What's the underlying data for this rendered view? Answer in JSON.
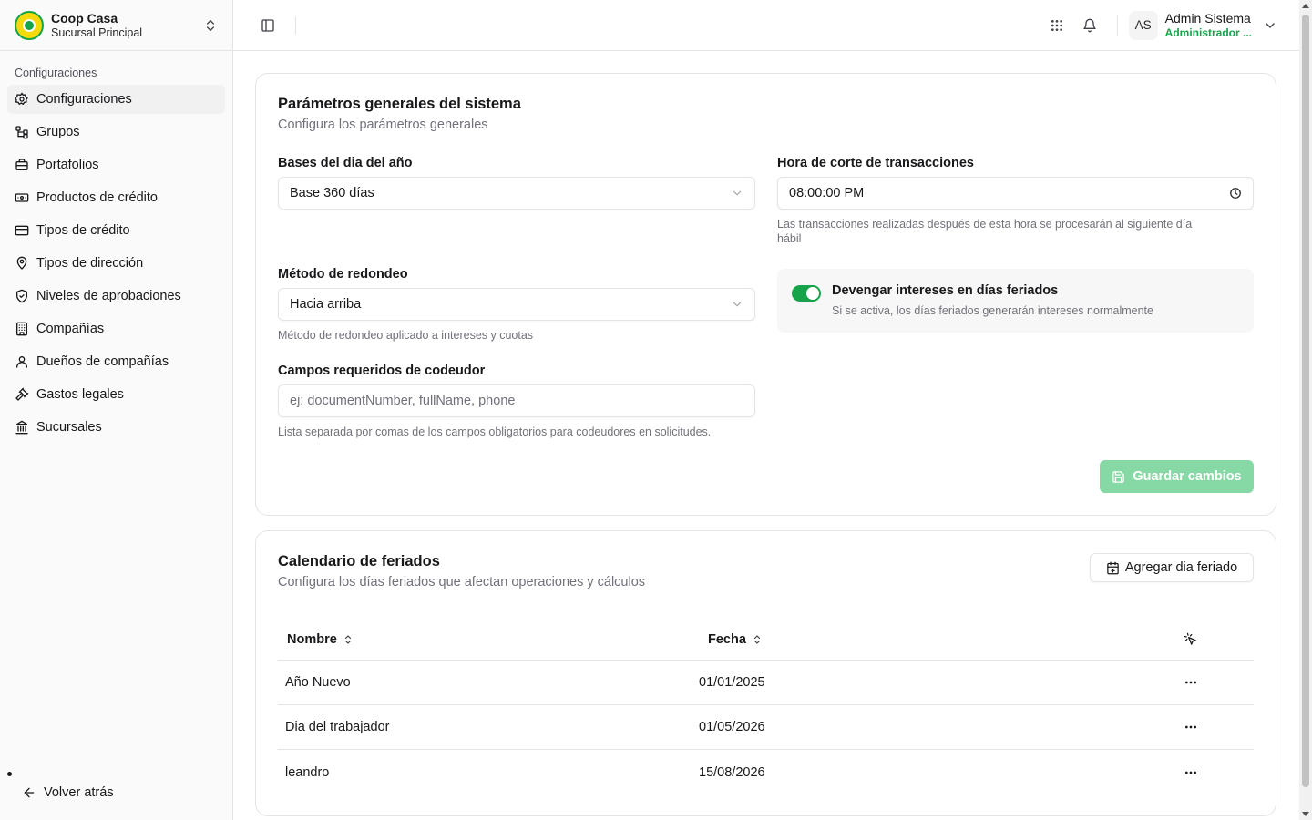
{
  "brand": {
    "name": "Coop Casa",
    "branch": "Sucursal Principal"
  },
  "sidebar": {
    "group_label": "Configuraciones",
    "items": [
      {
        "label": "Configuraciones",
        "icon": "gear-icon"
      },
      {
        "label": "Grupos",
        "icon": "network-icon"
      },
      {
        "label": "Portafolios",
        "icon": "briefcase-icon"
      },
      {
        "label": "Productos de crédito",
        "icon": "banknote-icon"
      },
      {
        "label": "Tipos de crédito",
        "icon": "credit-card-icon"
      },
      {
        "label": "Tipos de dirección",
        "icon": "map-pin-icon"
      },
      {
        "label": "Niveles de aprobaciones",
        "icon": "shield-check-icon"
      },
      {
        "label": "Compañías",
        "icon": "building-icon"
      },
      {
        "label": "Dueños de compañías",
        "icon": "user-icon"
      },
      {
        "label": "Gastos legales",
        "icon": "gavel-icon"
      },
      {
        "label": "Sucursales",
        "icon": "landmark-icon"
      }
    ],
    "back_label": "Volver atrás"
  },
  "header": {
    "user_initials": "AS",
    "user_name": "Admin Sistema",
    "user_role": "Administrador ..."
  },
  "general": {
    "title": "Parámetros generales del sistema",
    "description": "Configura los parámetros generales",
    "day_basis_label": "Bases del dia del año",
    "day_basis_value": "Base 360 días",
    "cutoff_label": "Hora de corte de transacciones",
    "cutoff_value": "08:00:00 PM",
    "cutoff_help_1": "Las transacciones realizadas después de esta hora se procesarán al siguiente día",
    "cutoff_help_2": "hábil",
    "rounding_label": "Método de redondeo",
    "rounding_value": "Hacia arriba",
    "rounding_help": "Método de redondeo aplicado a intereses y cuotas",
    "accrue_title": "Devengar intereses en días feriados",
    "accrue_desc": "Si se activa, los días feriados generarán intereses normalmente",
    "accrue_enabled": true,
    "codebtor_label": "Campos requeridos de codeudor",
    "codebtor_placeholder": "ej: documentNumber, fullName, phone",
    "codebtor_help": "Lista separada por comas de los campos obligatorios para codeudores en solicitudes.",
    "save_label": "Guardar cambios"
  },
  "holidays": {
    "title": "Calendario de feriados",
    "description": "Configura los días feriados que afectan operaciones y cálculos",
    "add_label": "Agregar dia feriado",
    "columns": {
      "name": "Nombre",
      "date": "Fecha"
    },
    "rows": [
      {
        "name": "Año Nuevo",
        "date": "01/01/2025"
      },
      {
        "name": "Dia del trabajador",
        "date": "01/05/2026"
      },
      {
        "name": "leandro",
        "date": "15/08/2026"
      }
    ]
  },
  "colors": {
    "accent": "#16a34a",
    "save_disabled": "#86d9a5",
    "logo_yellow": "#f5d90a"
  }
}
